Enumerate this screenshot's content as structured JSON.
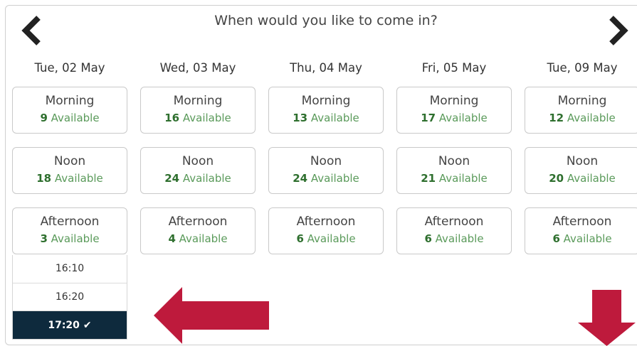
{
  "header": {
    "title": "When would you like to come in?"
  },
  "nav": {
    "prev_icon": "chevron-left-icon",
    "next_icon": "chevron-right-icon"
  },
  "days": [
    {
      "label": "Tue, 02 May",
      "slots": [
        {
          "name": "Morning",
          "count": "9",
          "avail": "Available"
        },
        {
          "name": "Noon",
          "count": "18",
          "avail": "Available"
        },
        {
          "name": "Afternoon",
          "count": "3",
          "avail": "Available"
        }
      ]
    },
    {
      "label": "Wed, 03 May",
      "slots": [
        {
          "name": "Morning",
          "count": "16",
          "avail": "Available"
        },
        {
          "name": "Noon",
          "count": "24",
          "avail": "Available"
        },
        {
          "name": "Afternoon",
          "count": "4",
          "avail": "Available"
        }
      ]
    },
    {
      "label": "Thu, 04 May",
      "slots": [
        {
          "name": "Morning",
          "count": "13",
          "avail": "Available"
        },
        {
          "name": "Noon",
          "count": "24",
          "avail": "Available"
        },
        {
          "name": "Afternoon",
          "count": "6",
          "avail": "Available"
        }
      ]
    },
    {
      "label": "Fri, 05 May",
      "slots": [
        {
          "name": "Morning",
          "count": "17",
          "avail": "Available"
        },
        {
          "name": "Noon",
          "count": "21",
          "avail": "Available"
        },
        {
          "name": "Afternoon",
          "count": "6",
          "avail": "Available"
        }
      ]
    },
    {
      "label": "Tue, 09 May",
      "slots": [
        {
          "name": "Morning",
          "count": "12",
          "avail": "Available"
        },
        {
          "name": "Noon",
          "count": "20",
          "avail": "Available"
        },
        {
          "name": "Afternoon",
          "count": "6",
          "avail": "Available"
        }
      ]
    }
  ],
  "times": [
    {
      "label": "16:10"
    },
    {
      "label": "16:20"
    },
    {
      "label": "17:20",
      "selected": true,
      "check": "✔"
    }
  ],
  "colors": {
    "available_text": "#5a9a5a",
    "available_count": "#2e6f2e",
    "selected_bg": "#0e2a3d",
    "annotation_arrow": "#be1a3c"
  },
  "annotations": {
    "left_arrow_icon": "arrow-left-icon",
    "down_arrow_icon": "arrow-down-icon"
  }
}
